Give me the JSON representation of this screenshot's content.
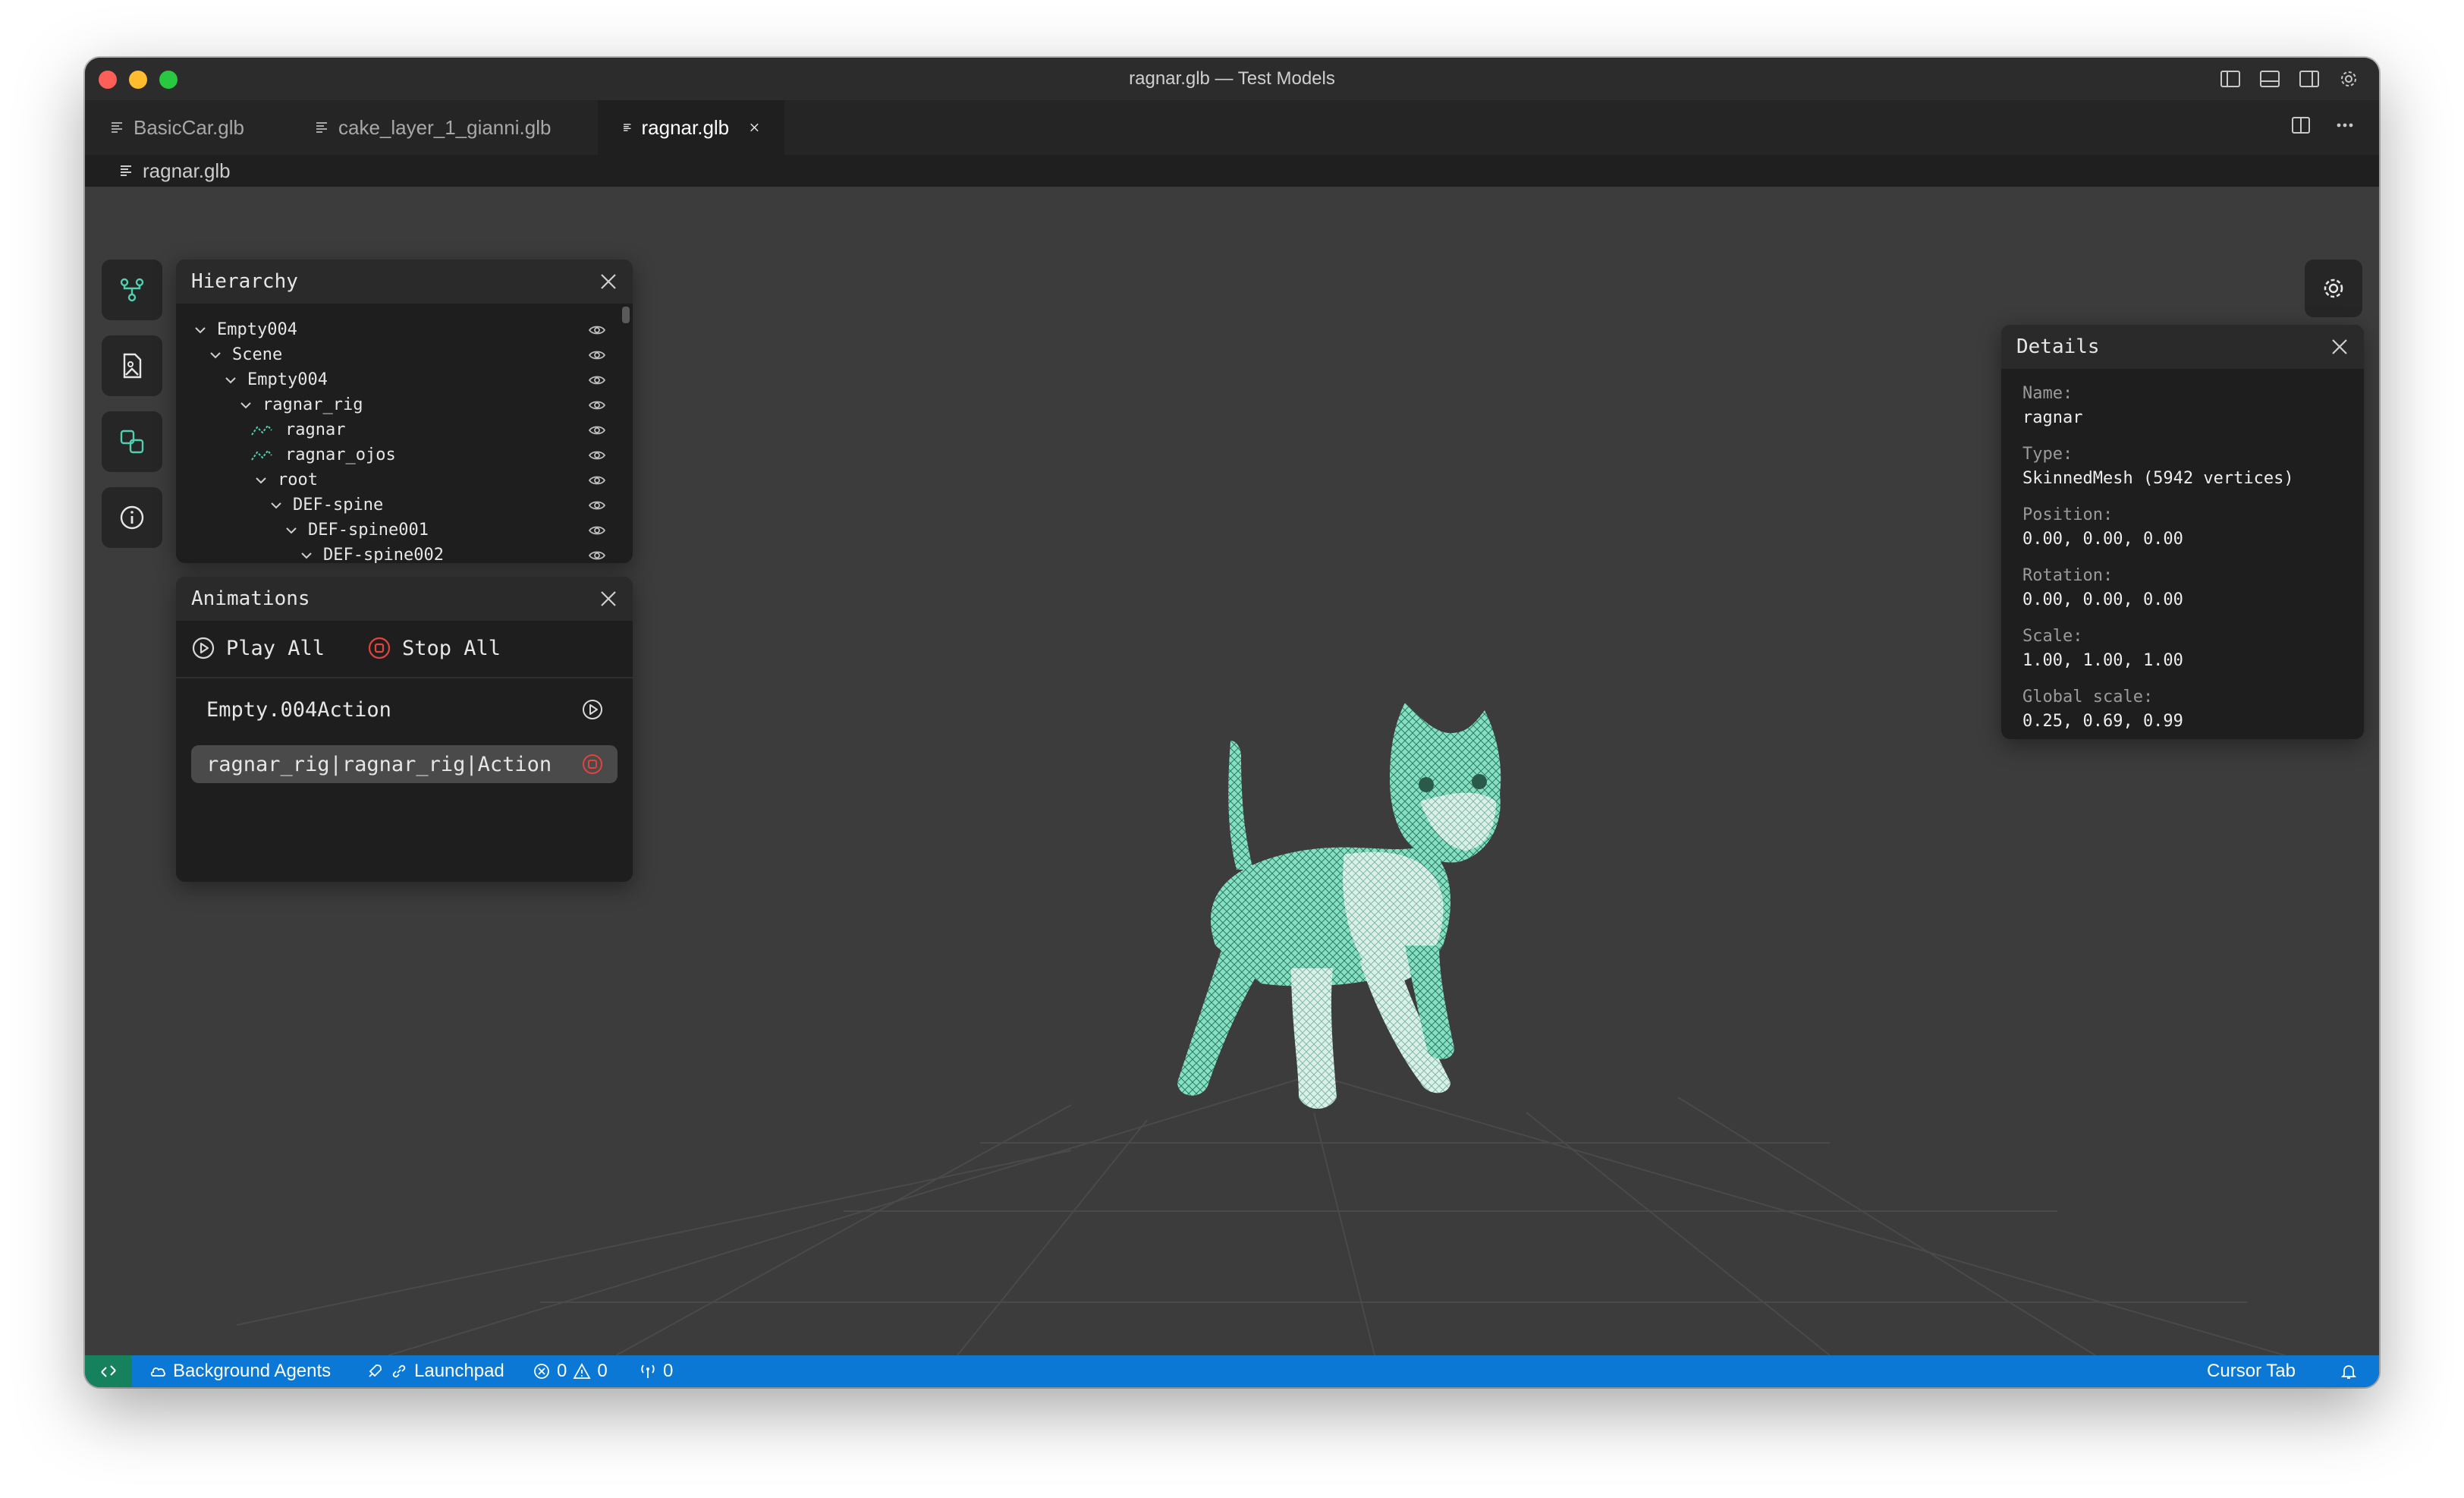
{
  "window": {
    "title": "ragnar.glb — Test Models"
  },
  "tabs": [
    {
      "label": "BasicCar.glb",
      "active": false
    },
    {
      "label": "cake_layer_1_gianni.glb",
      "active": false
    },
    {
      "label": "ragnar.glb",
      "active": true
    }
  ],
  "breadcrumb": {
    "label": "ragnar.glb"
  },
  "sidebar": {
    "buttons": [
      "hierarchy-icon",
      "image-file-icon",
      "shapes-icon",
      "info-icon"
    ]
  },
  "hierarchy": {
    "title": "Hierarchy",
    "rows": [
      {
        "label": "Empty004",
        "kind": "group"
      },
      {
        "label": "Scene",
        "kind": "group"
      },
      {
        "label": "Empty004",
        "kind": "group"
      },
      {
        "label": "ragnar_rig",
        "kind": "group"
      },
      {
        "label": "ragnar",
        "kind": "mesh"
      },
      {
        "label": "ragnar_ojos",
        "kind": "mesh"
      },
      {
        "label": "root",
        "kind": "group"
      },
      {
        "label": "DEF-spine",
        "kind": "group"
      },
      {
        "label": "DEF-spine001",
        "kind": "group"
      },
      {
        "label": "DEF-spine002",
        "kind": "group"
      }
    ]
  },
  "animations": {
    "title": "Animations",
    "play_all": "Play All",
    "stop_all": "Stop All",
    "items": [
      {
        "name": "Empty.004Action",
        "playing": false
      },
      {
        "name": "ragnar_rig|ragnar_rig|Action",
        "playing": true
      }
    ]
  },
  "details": {
    "title": "Details",
    "fields": [
      {
        "label": "Name:",
        "value": "ragnar"
      },
      {
        "label": "Type:",
        "value": "SkinnedMesh (5942 vertices)"
      },
      {
        "label": "Position:",
        "value": "0.00, 0.00, 0.00"
      },
      {
        "label": "Rotation:",
        "value": "0.00, 0.00, 0.00"
      },
      {
        "label": "Scale:",
        "value": "1.00, 1.00, 1.00"
      },
      {
        "label": "Global scale:",
        "value": "0.25, 0.69, 0.99"
      }
    ]
  },
  "statusbar": {
    "background_agents": "Background Agents",
    "launchpad": "Launchpad",
    "errors": "0",
    "warnings": "0",
    "ports": "0",
    "cursor_tab": "Cursor Tab"
  },
  "colors": {
    "accent": "#4fd1b0",
    "statusbar": "#0a78d4",
    "remote": "#16825d",
    "stop": "#e0443e"
  }
}
